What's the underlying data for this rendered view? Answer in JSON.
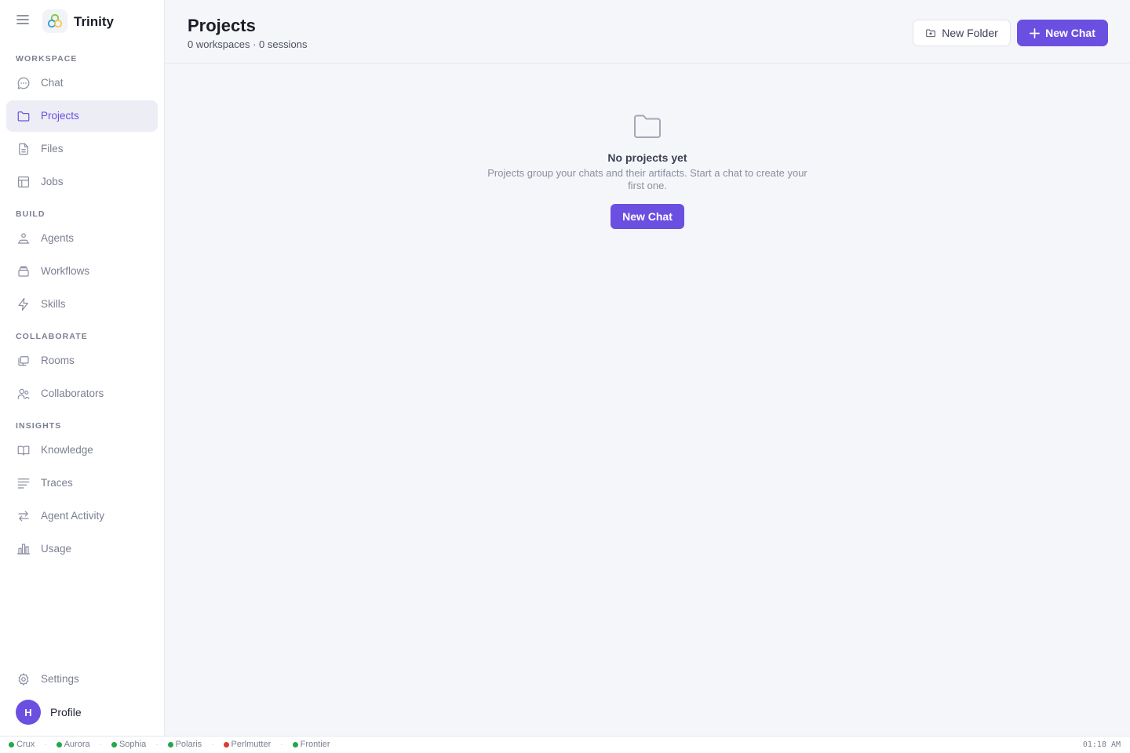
{
  "app": {
    "name": "Trinity"
  },
  "sidebar": {
    "sections": {
      "workspace": "WORKSPACE",
      "build": "BUILD",
      "collaborate": "COLLABORATE",
      "insights": "INSIGHTS"
    },
    "items": {
      "chat": {
        "label": "Chat",
        "icon": "chat-bubble-icon"
      },
      "projects": {
        "label": "Projects",
        "icon": "folder-icon",
        "active": true
      },
      "files": {
        "label": "Files",
        "icon": "file-icon"
      },
      "jobs": {
        "label": "Jobs",
        "icon": "table-icon"
      },
      "agents": {
        "label": "Agents",
        "icon": "agents-icon"
      },
      "workflows": {
        "label": "Workflows",
        "icon": "layers-icon"
      },
      "skills": {
        "label": "Skills",
        "icon": "lightning-icon"
      },
      "rooms": {
        "label": "Rooms",
        "icon": "rooms-icon"
      },
      "collaborators": {
        "label": "Collaborators",
        "icon": "users-icon"
      },
      "knowledge": {
        "label": "Knowledge",
        "icon": "book-icon"
      },
      "traces": {
        "label": "Traces",
        "icon": "lines-icon"
      },
      "agent_activity": {
        "label": "Agent Activity",
        "icon": "arrows-icon"
      },
      "usage": {
        "label": "Usage",
        "icon": "bar-chart-icon"
      },
      "settings": {
        "label": "Settings",
        "icon": "gear-icon"
      }
    },
    "profile": {
      "initial": "H",
      "label": "Profile"
    }
  },
  "header": {
    "title": "Projects",
    "subtitle": "0 workspaces · 0 sessions",
    "new_folder_label": "New Folder",
    "new_chat_label": "New Chat"
  },
  "empty_state": {
    "title": "No projects yet",
    "description": "Projects group your chats and their artifacts. Start a chat to create your first one.",
    "button_label": "New Chat"
  },
  "statusbar": {
    "agents": [
      {
        "name": "Crux",
        "status_color": "#22a84a"
      },
      {
        "name": "Aurora",
        "status_color": "#22a84a"
      },
      {
        "name": "Sophia",
        "status_color": "#22a84a"
      },
      {
        "name": "Polaris",
        "status_color": "#22a84a"
      },
      {
        "name": "Perlmutter",
        "status_color": "#e03a2f"
      },
      {
        "name": "Frontier",
        "status_color": "#22a84a"
      }
    ],
    "time": "01:18 AM"
  },
  "colors": {
    "accent": "#6b4fe0",
    "online": "#22a84a",
    "offline": "#e03a2f"
  }
}
